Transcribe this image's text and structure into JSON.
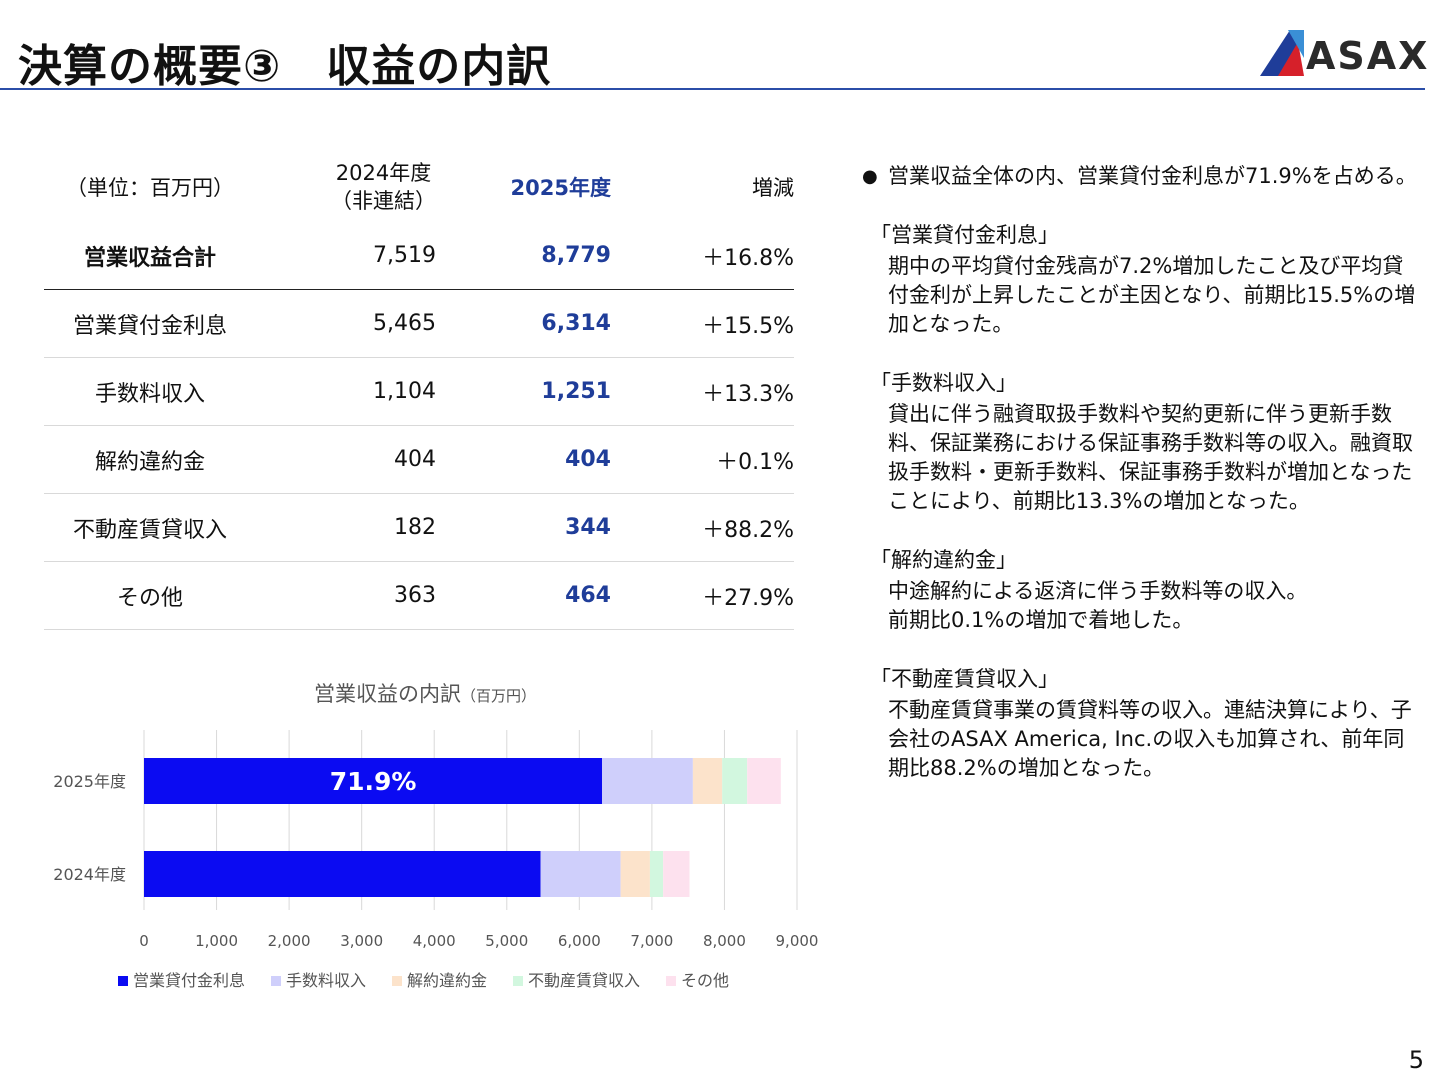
{
  "header": {
    "title": "決算の概要③　収益の内訳",
    "logo_text": "ASAX",
    "page_number": "5"
  },
  "table": {
    "unit_label": "（単位：百万円）",
    "col_prev": "2024年度\n（非連結）",
    "col_now": "2025年度",
    "col_change": "増減",
    "rows": [
      {
        "label": "営業収益合計",
        "prev": "7,519",
        "now": "8,779",
        "change": "＋16.8%"
      },
      {
        "label": "営業貸付金利息",
        "prev": "5,465",
        "now": "6,314",
        "change": "＋15.5%"
      },
      {
        "label": "手数料収入",
        "prev": "1,104",
        "now": "1,251",
        "change": "＋13.3%"
      },
      {
        "label": "解約違約金",
        "prev": "404",
        "now": "404",
        "change": "＋0.1%"
      },
      {
        "label": "不動産賃貸収入",
        "prev": "182",
        "now": "344",
        "change": "＋88.2%"
      },
      {
        "label": "その他",
        "prev": "363",
        "now": "464",
        "change": "＋27.9%"
      }
    ]
  },
  "chart_title": {
    "main": "営業収益の内訳",
    "unit": "（百万円）"
  },
  "chart_data": {
    "type": "bar",
    "orientation": "horizontal",
    "stacked": true,
    "categories": [
      "2025年度",
      "2024年度"
    ],
    "series": [
      {
        "name": "営業貸付金利息",
        "values": [
          6314,
          5465
        ],
        "color": "#0b0bf2"
      },
      {
        "name": "手数料収入",
        "values": [
          1251,
          1104
        ],
        "color": "#cfcffb"
      },
      {
        "name": "解約違約金",
        "values": [
          404,
          404
        ],
        "color": "#fce3cb"
      },
      {
        "name": "不動産賃貸収入",
        "values": [
          344,
          182
        ],
        "color": "#d2f7df"
      },
      {
        "name": "その他",
        "values": [
          464,
          363
        ],
        "color": "#fde1ee"
      }
    ],
    "annotation": "71.9%",
    "xlim": [
      0,
      9000
    ],
    "xticks": [
      "0",
      "1,000",
      "2,000",
      "3,000",
      "4,000",
      "5,000",
      "6,000",
      "7,000",
      "8,000",
      "9,000"
    ],
    "grid": true,
    "legend": "bottom"
  },
  "notes": {
    "bullet": "営業収益全体の内、営業貸付金利息が71.9%を占める。",
    "sections": [
      {
        "heading": "「営業貸付金利息」",
        "body": "期中の平均貸付金残高が7.2%増加したこと及び平均貸付金利が上昇したことが主因となり、前期比15.5%の増加となった。"
      },
      {
        "heading": "「手数料収入」",
        "body": "貸出に伴う融資取扱手数料や契約更新に伴う更新手数料、保証業務における保証事務手数料等の収入。融資取扱手数料・更新手数料、保証事務手数料が増加となったことにより、前期比13.3%の増加となった。"
      },
      {
        "heading": "「解約違約金」",
        "body": "中途解約による返済に伴う手数料等の収入。\n前期比0.1%の増加で着地した。"
      },
      {
        "heading": "「不動産賃貸収入」",
        "body": "不動産賃貸事業の賃貸料等の収入。連結決算により、子会社のASAX America, Inc.の収入も加算され、前年同期比88.2%の増加となった。"
      }
    ]
  }
}
